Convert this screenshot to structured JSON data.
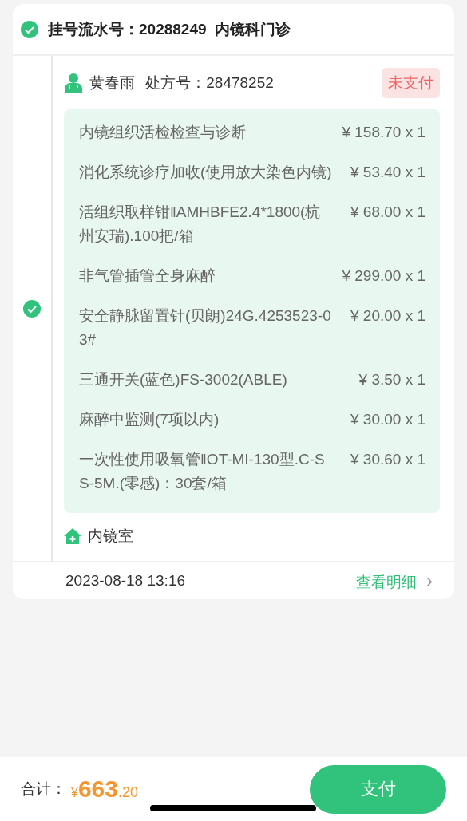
{
  "registration": {
    "checked": true,
    "label": "挂号流水号：",
    "number": "20288249",
    "department": "内镜科门诊"
  },
  "prescription": {
    "checked": true,
    "doctor": "黄春雨",
    "rx_label": "处方号：",
    "rx_number": "28478252",
    "status": "未支付",
    "paid": false,
    "items": [
      {
        "name": "内镜组织活检检查与诊断",
        "price": "¥ 158.70 x 1"
      },
      {
        "name": "消化系统诊疗加收(使用放大染色内镜)",
        "price": "¥ 53.40 x 1"
      },
      {
        "name": "活组织取样钳‖AMHBFE2.4*1800(杭州安瑞).100把/箱",
        "price": "¥ 68.00 x 1"
      },
      {
        "name": "非气管插管全身麻醉",
        "price": "¥ 299.00 x 1"
      },
      {
        "name": "安全静脉留置针(贝朗)24G.4253523-03#",
        "price": "¥ 20.00 x 1"
      },
      {
        "name": "三通开关(蓝色)FS-3002(ABLE)",
        "price": "¥ 3.50 x 1"
      },
      {
        "name": "麻醉中监测(7项以内)",
        "price": "¥ 30.00 x 1"
      },
      {
        "name": "一次性使用吸氧管‖OT-MI-130型.C-SS-5M.(零感)：30套/箱",
        "price": "¥ 30.60 x 1"
      }
    ],
    "room": "内镜室"
  },
  "footer": {
    "date": "2023-08-18 13:16",
    "detail_link": "查看明细",
    "chevron": "›"
  },
  "bottom_bar": {
    "total_label": "合计：",
    "currency": "¥",
    "amount_integer": "663",
    "amount_decimal": ".20",
    "pay_button": "支付"
  }
}
